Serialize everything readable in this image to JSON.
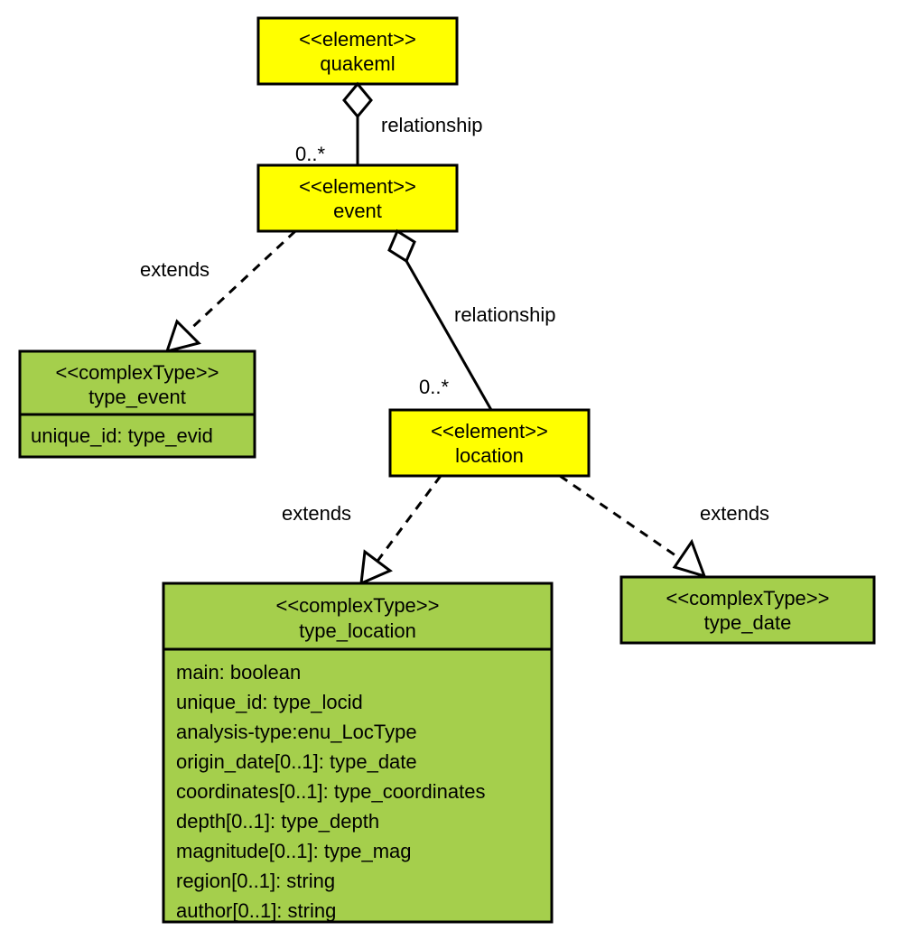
{
  "nodes": {
    "quakeml": {
      "stereo": "<<element>>",
      "name": "quakeml"
    },
    "event": {
      "stereo": "<<element>>",
      "name": "event"
    },
    "location": {
      "stereo": "<<element>>",
      "name": "location"
    },
    "type_event": {
      "stereo": "<<complexType>>",
      "name": "type_event",
      "attrs": [
        "unique_id: type_evid"
      ]
    },
    "type_location": {
      "stereo": "<<complexType>>",
      "name": "type_location",
      "attrs": [
        "main: boolean",
        "unique_id: type_locid",
        "analysis-type:enu_LocType",
        "origin_date[0..1]: type_date",
        "coordinates[0..1]: type_coordinates",
        "depth[0..1]: type_depth",
        "magnitude[0..1]: type_mag",
        "region[0..1]: string",
        "author[0..1]: string"
      ]
    },
    "type_date": {
      "stereo": "<<complexType>>",
      "name": "type_date"
    }
  },
  "edges": {
    "quakeml_event": {
      "label": "relationship",
      "mult": "0..*"
    },
    "event_location": {
      "label": "relationship",
      "mult": "0..*"
    },
    "event_typeevent": {
      "label": "extends"
    },
    "location_typeloc": {
      "label": "extends"
    },
    "location_typedate": {
      "label": "extends"
    }
  }
}
